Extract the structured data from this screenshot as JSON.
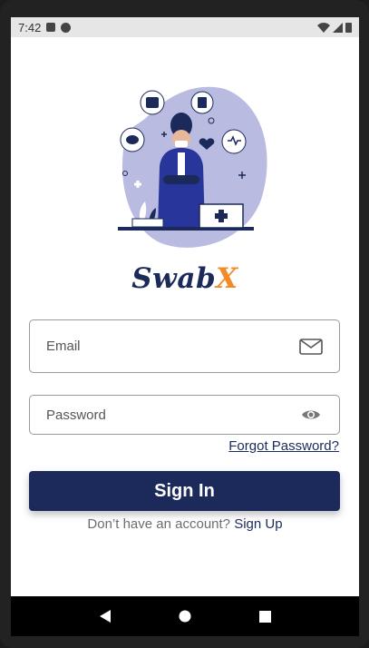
{
  "status_bar": {
    "time": "7:42"
  },
  "brand": {
    "name_part1": "Swab",
    "name_part2": "X"
  },
  "email": {
    "placeholder": "Email",
    "value": ""
  },
  "password": {
    "placeholder": "Password",
    "value": ""
  },
  "forgot_password_label": "Forgot Password?",
  "sign_in_label": "Sign In",
  "signup": {
    "prompt": "Don’t have an account?",
    "link_label": "Sign Up"
  },
  "colors": {
    "primary": "#1b2a5a",
    "accent": "#f28c28",
    "illustration_blob": "#b9bbe0"
  },
  "icons": {
    "email": "envelope-icon",
    "password": "eye-icon",
    "nav_back": "triangle-back-icon",
    "nav_home": "circle-home-icon",
    "nav_recents": "square-recents-icon"
  }
}
